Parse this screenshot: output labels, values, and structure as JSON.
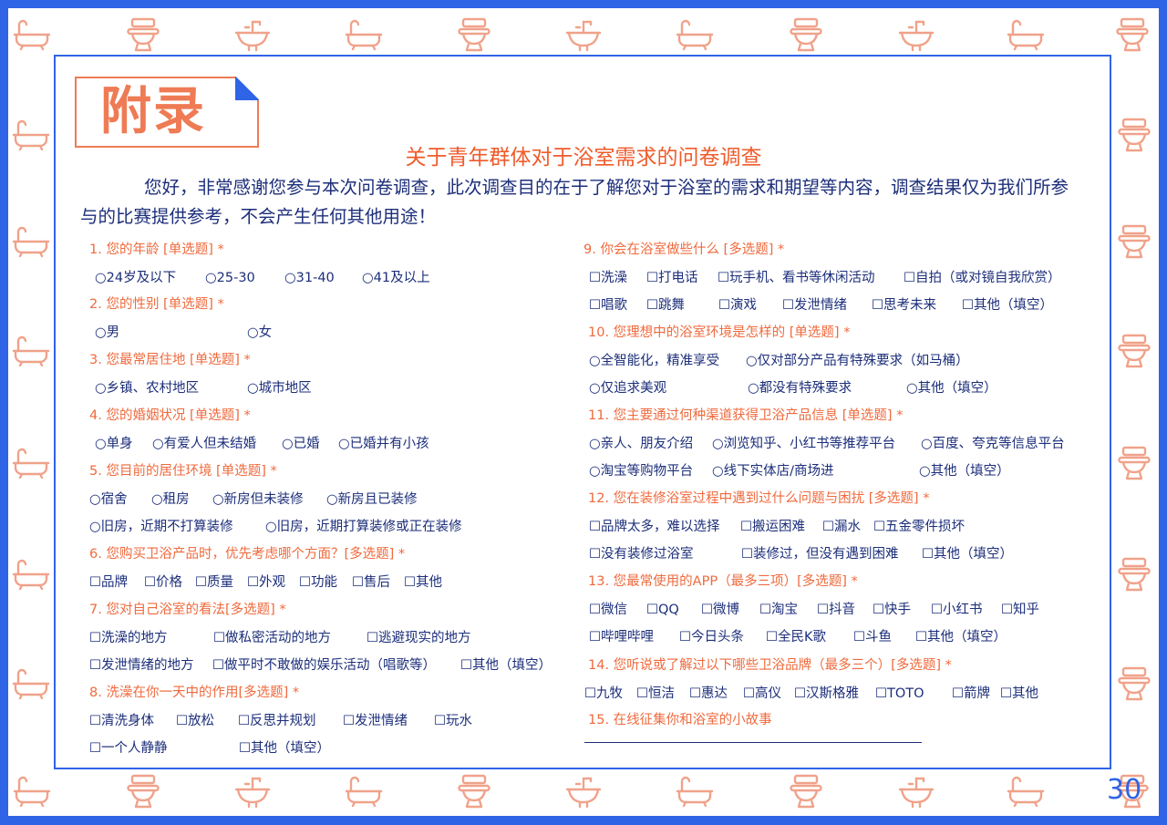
{
  "header": {
    "title": "附录",
    "survey_title": "关于青年群体对于浴室需求的问卷调查",
    "intro": "您好，非常感谢您参与本次问卷调查，此次调查目的在于了解您对于浴室的需求和期望等内容，调查结果仅为我们所参与的比赛提供参考，不会产生任何其他用途！"
  },
  "questions": [
    {
      "id": "q1",
      "text": "1. 您的年龄 [单选题] *",
      "options": [
        "○24岁及以下",
        "○25-30",
        "○31-40",
        "○41及以上"
      ]
    },
    {
      "id": "q2",
      "text": "2. 您的性别 [单选题] *",
      "options": [
        "○男",
        "○女"
      ]
    },
    {
      "id": "q3",
      "text": "3. 您最常居住地 [单选题] *",
      "options": [
        "○乡镇、农村地区",
        "○城市地区"
      ]
    },
    {
      "id": "q4",
      "text": "4. 您的婚姻状况 [单选题] *",
      "options": [
        "○单身",
        "○有爱人但未结婚",
        "○已婚",
        "○已婚并有小孩"
      ]
    },
    {
      "id": "q5",
      "text": "5. 您目前的居住环境 [单选题] *",
      "options": [
        "○宿舍",
        "○租房",
        "○新房但未装修",
        "○新房且已装修",
        "○旧房，近期不打算装修",
        "○旧房，近期打算装修或正在装修"
      ]
    },
    {
      "id": "q6",
      "text": "6. 您购买卫浴产品时，优先考虑哪个方面？[多选题] *",
      "options": [
        "☐品牌",
        "☐价格",
        "☐质量",
        "☐外观",
        "☐功能",
        "☐售后",
        "☐其他"
      ]
    },
    {
      "id": "q7",
      "text": "7. 您对自己浴室的看法[多选题] *",
      "options": [
        "☐洗澡的地方",
        "☐做私密活动的地方",
        "☐逃避现实的地方",
        "☐发泄情绪的地方",
        "☐做平时不敢做的娱乐活动（唱歌等）",
        "☐其他（填空）"
      ]
    },
    {
      "id": "q8",
      "text": "8. 洗澡在你一天中的作用[多选题] *",
      "options": [
        "☐清洗身体",
        "☐放松",
        "☐反思并规划",
        "☐发泄情绪",
        "☐玩水",
        "☐一个人静静",
        "☐其他（填空）"
      ]
    },
    {
      "id": "q9",
      "text": "9. 你会在浴室做些什么 [多选题] *",
      "options": [
        "☐洗澡",
        "☐打电话",
        "☐玩手机、看书等休闲活动",
        "☐自拍（或对镜自我欣赏）",
        "☐唱歌",
        "☐跳舞",
        "☐演戏",
        "☐发泄情绪",
        "☐思考未来",
        "☐其他（填空）"
      ]
    },
    {
      "id": "q10",
      "text": "10. 您理想中的浴室环境是怎样的 [单选题] *",
      "options": [
        "○全智能化，精准享受",
        "○仅对部分产品有特殊要求（如马桶）",
        "○仅追求美观",
        "○都没有特殊要求",
        "○其他（填空）"
      ]
    },
    {
      "id": "q11",
      "text": "11. 您主要通过何种渠道获得卫浴产品信息 [单选题] *",
      "options": [
        "○亲人、朋友介绍",
        "○浏览知乎、小红书等推荐平台",
        "○百度、夸克等信息平台",
        "○淘宝等购物平台",
        "○线下实体店/商场进",
        "○其他（填空）"
      ]
    },
    {
      "id": "q12",
      "text": "12. 您在装修浴室过程中遇到过什么问题与困扰 [多选题] *",
      "options": [
        "☐品牌太多，难以选择",
        "☐搬运困难",
        "☐漏水",
        "☐五金零件损坏",
        "☐没有装修过浴室",
        "☐装修过，但没有遇到困难",
        "☐其他（填空）"
      ]
    },
    {
      "id": "q13",
      "text": "13. 您最常使用的APP（最多三项）[多选题] *",
      "options": [
        "☐微信",
        "☐QQ",
        "☐微博",
        "☐淘宝",
        "☐抖音",
        "☐快手",
        "☐小红书",
        "☐知乎",
        "☐哔哩哔哩",
        "☐今日头条",
        "☐全民K歌",
        "☐斗鱼",
        "☐其他（填空）"
      ]
    },
    {
      "id": "q14",
      "text": "14. 您听说或了解过以下哪些卫浴品牌（最多三个）[多选题] *",
      "options": [
        "☐九牧",
        "☐恒洁",
        "☐惠达",
        "☐高仪",
        "☐汉斯格雅",
        "☐TOTO",
        "☐箭牌",
        "☐其他"
      ]
    },
    {
      "id": "q15",
      "text": "15.  在线征集你和浴室的小故事",
      "options": []
    }
  ],
  "footer": {
    "page_number": "30"
  },
  "colors": {
    "border_blue": "#2f64e6",
    "accent_orange": "#ef7b55",
    "text_navy": "#1c2e7a",
    "icon_salmon": "#f0a28a"
  },
  "border_icons": [
    "bathtub-icon",
    "toilet-icon",
    "sink-icon"
  ]
}
